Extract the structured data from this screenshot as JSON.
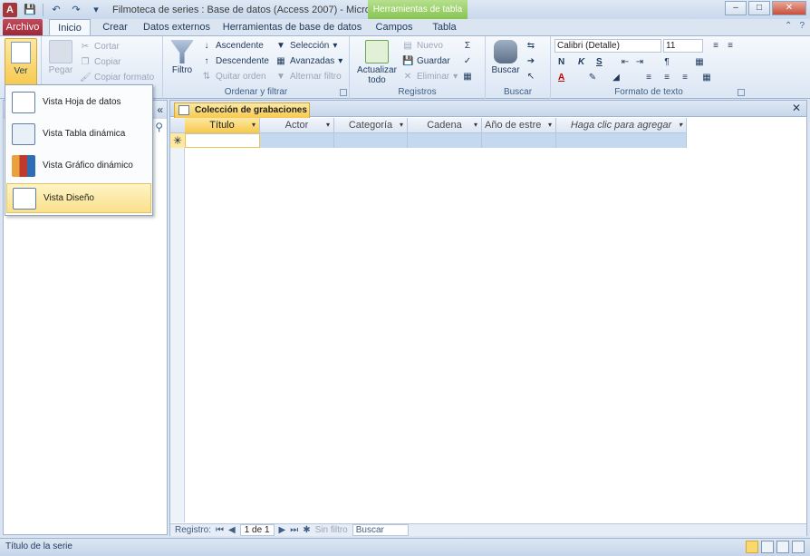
{
  "titlebar": {
    "app_icon": "A",
    "title": "Filmoteca de series : Base de datos (Access 2007) - Micro...",
    "context_tools": "Herramientas de tabla",
    "qat": {
      "save": "save-icon",
      "undo": "undo-icon",
      "redo": "redo-icon",
      "customize": "customize-icon"
    },
    "buttons": {
      "minimize": "–",
      "restore": "□",
      "close": "✕"
    }
  },
  "tabs": {
    "archivo": "Archivo",
    "inicio": "Inicio",
    "crear": "Crear",
    "datos_externos": "Datos externos",
    "herramientas_bd": "Herramientas de base de datos",
    "campos": "Campos",
    "tabla": "Tabla"
  },
  "ribbon": {
    "vistas": {
      "ver": "Ver"
    },
    "portapapeles": {
      "pegar": "Pegar",
      "cortar": "Cortar",
      "copiar": "Copiar",
      "copiar_formato": "Copiar formato"
    },
    "ordenar": {
      "label": "Ordenar y filtrar",
      "filtro": "Filtro",
      "ascendente": "Ascendente",
      "descendente": "Descendente",
      "quitar_orden": "Quitar orden",
      "seleccion": "Selección",
      "avanzadas": "Avanzadas",
      "alternar_filtro": "Alternar filtro"
    },
    "registros": {
      "label": "Registros",
      "actualizar": "Actualizar",
      "todo": "todo",
      "nuevo": "Nuevo",
      "guardar": "Guardar",
      "eliminar": "Eliminar"
    },
    "buscar": {
      "label": "Buscar",
      "buscar_btn": "Buscar"
    },
    "formato": {
      "label": "Formato de texto",
      "font": "Calibri (Detalle)",
      "size": "11",
      "bold": "N",
      "italic": "K",
      "underline": "S",
      "font_color": "A"
    }
  },
  "views_menu": {
    "items": [
      "Vista Hoja de datos",
      "Vista Tabla dinámica",
      "Vista Gráfico dinámico",
      "Vista Diseño"
    ],
    "highlighted": "Vista Diseño"
  },
  "nav_pane": {
    "collapse": "«",
    "search": "search-icon"
  },
  "document": {
    "tab_title": "Colección de grabaciones",
    "close": "✕",
    "columns": [
      "Título",
      "Actor",
      "Categoría",
      "Cadena",
      "Año de estre",
      "Haga clic para agregar"
    ],
    "new_row_marker": "✳"
  },
  "record_nav": {
    "registro_label": "Registro:",
    "current": "1 de 1",
    "filter": "Sin filtro",
    "search": "Buscar"
  },
  "statusbar": {
    "text": "Título de la serie"
  }
}
